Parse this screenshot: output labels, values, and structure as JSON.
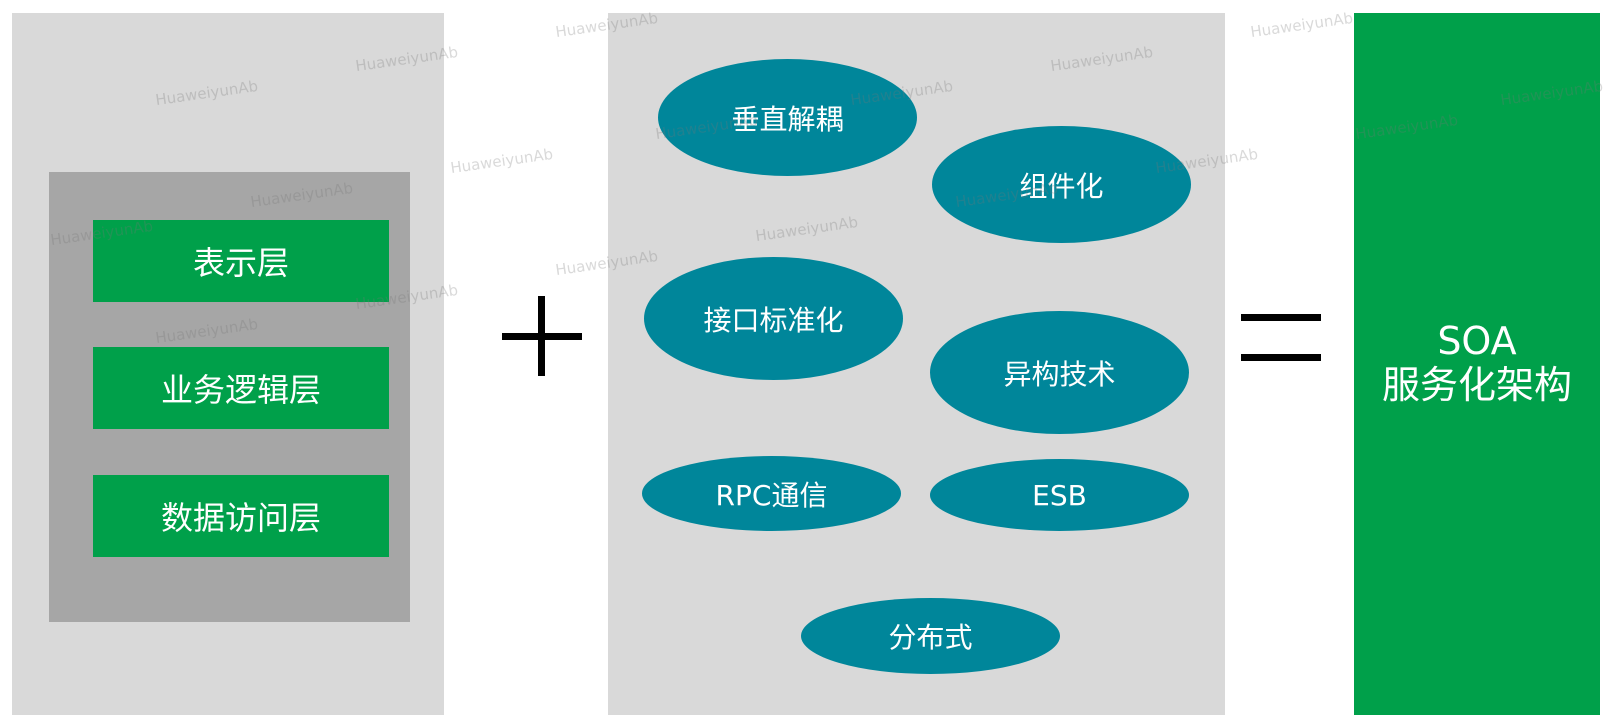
{
  "layers": [
    "表示层",
    "业务逻辑层",
    "数据访问层"
  ],
  "concepts": [
    "垂直解耦",
    "组件化",
    "接口标准化",
    "异构技术",
    "RPC通信",
    "ESB",
    "分布式"
  ],
  "result": {
    "line1": "SOA",
    "line2": "服务化架构"
  },
  "watermark": "HuaweiyunAb",
  "colors": {
    "panel": "#d9d9d9",
    "layer_box": "#a6a6a6",
    "green": "#00a04a",
    "teal": "#00869a"
  }
}
